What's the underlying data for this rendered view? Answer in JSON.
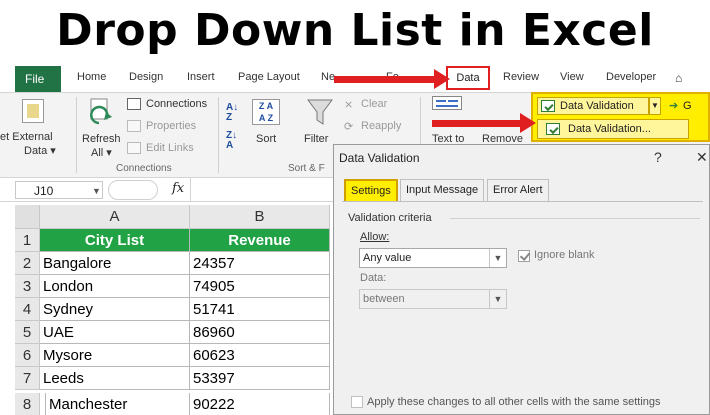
{
  "title": "Drop Down List in Excel",
  "tabs": {
    "file": "File",
    "home": "Home",
    "design": "Design",
    "insert": "Insert",
    "page_layout": "Page Layout",
    "new_tab": "Ne",
    "formulas": "Fo",
    "data": "Data",
    "review": "Review",
    "view": "View",
    "developer": "Developer"
  },
  "ribbon": {
    "get_external_line1": "et External",
    "get_external_line2": "Data ▾",
    "refresh_line1": "Refresh",
    "refresh_line2": "All ▾",
    "connections": "Connections",
    "properties": "Properties",
    "edit_links": "Edit Links",
    "connections_group": "Connections",
    "sort": "Sort",
    "filter": "Filter",
    "clear": "Clear",
    "reapply": "Reapply",
    "sort_filter_group": "Sort & F",
    "text_to": "Text to",
    "remove": "Remove",
    "data_validation": "Data Validation",
    "goal": "G",
    "data_validation_item": "Data Validation..."
  },
  "formula_bar": {
    "name_box": "J10",
    "fx": "fx"
  },
  "sheet": {
    "columns": [
      "A",
      "B"
    ],
    "rows": [
      {
        "num": "1",
        "a": "City List",
        "b": "Revenue",
        "header": true
      },
      {
        "num": "2",
        "a": "Bangalore",
        "b": "24357"
      },
      {
        "num": "3",
        "a": "London",
        "b": "74905"
      },
      {
        "num": "4",
        "a": "Sydney",
        "b": "51741"
      },
      {
        "num": "5",
        "a": "UAE",
        "b": "86960"
      },
      {
        "num": "6",
        "a": "Mysore",
        "b": "60623"
      },
      {
        "num": "7",
        "a": "Leeds",
        "b": "53397"
      },
      {
        "num": "8",
        "a": "Manchester",
        "b": "90222"
      }
    ]
  },
  "dialog": {
    "title": "Data Validation",
    "help": "?",
    "close": "✕",
    "tab_settings": "Settings",
    "tab_input": "Input Message",
    "tab_error": "Error Alert",
    "criteria": "Validation criteria",
    "allow_label": "Allow:",
    "allow_value": "Any value",
    "ignore_blank": "Ignore blank",
    "data_label": "Data:",
    "data_value": "between",
    "apply_all": "Apply these changes to all other cells with the same settings"
  },
  "colors": {
    "excel_green": "#217346",
    "header_fill": "#21a244",
    "highlight_yellow": "#ffee00",
    "arrow_red": "#e02020"
  }
}
